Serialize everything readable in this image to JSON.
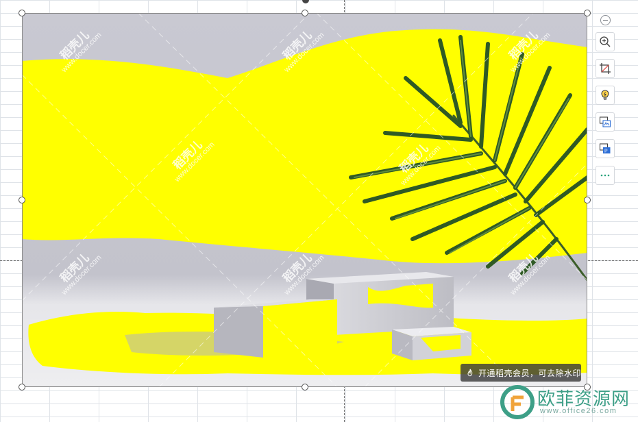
{
  "image": {
    "description_icon": "product-podium-photo",
    "highlight_color": "#ffff00"
  },
  "watermark": {
    "line1": "稻壳儿",
    "line2": "www.docer.com"
  },
  "remove_watermark_banner": {
    "text": "开通稻壳会员，可去除水印"
  },
  "toolbar": {
    "collapse": "collapse-icon",
    "buttons": [
      {
        "name": "zoom-in-icon"
      },
      {
        "name": "crop-icon"
      },
      {
        "name": "smart-idea-icon"
      },
      {
        "name": "image-to-text-icon"
      },
      {
        "name": "image-to-pdf-icon"
      },
      {
        "name": "more-icon"
      }
    ]
  },
  "site_logo": {
    "brand": "欧菲资源网",
    "domain": "www.office26.com",
    "color": "#3d9f87"
  }
}
